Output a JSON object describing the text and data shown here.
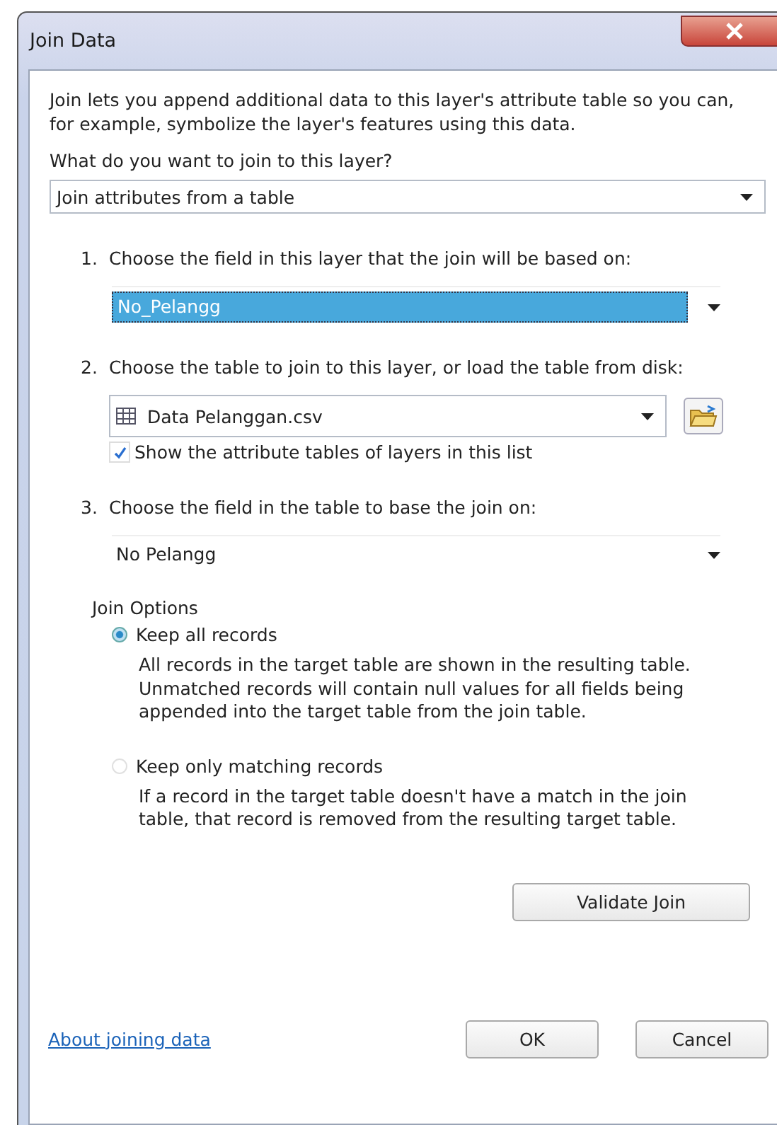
{
  "window": {
    "title": "Join Data"
  },
  "intro": "Join lets you append additional data to this layer's attribute table so you can, for example, symbolize the layer's features using this data.",
  "join_type": {
    "label": "What do you want to join to this layer?",
    "value": "Join attributes from a table"
  },
  "steps": [
    {
      "kind": "field-select",
      "number": "1.",
      "label": "Choose the field in this layer that the join will be based on:",
      "value": "No_Pelangg",
      "selected": true
    },
    {
      "kind": "table-select",
      "number": "2.",
      "label": "Choose the table to join to this layer, or load the table from disk:",
      "value": "Data Pelanggan.csv",
      "checkbox": {
        "label": "Show the attribute tables of layers in this list",
        "checked": true
      }
    },
    {
      "kind": "field-select",
      "number": "3.",
      "label": "Choose the field in the table to base the join on:",
      "value": "No Pelangg",
      "selected": false
    }
  ],
  "join_options": {
    "title": "Join Options",
    "options": [
      {
        "label": "Keep all records",
        "description": "All records in the target table are shown in the resulting table. Unmatched records will contain null values for all fields being appended into the target table from the join table.",
        "selected": true
      },
      {
        "label": "Keep only matching records",
        "description": "If a record in the target table doesn't have a match in the join table, that record is removed from the resulting target table.",
        "selected": false
      }
    ]
  },
  "validate_button": "Validate Join",
  "help_link": "About joining data",
  "buttons": [
    "OK",
    "Cancel"
  ]
}
